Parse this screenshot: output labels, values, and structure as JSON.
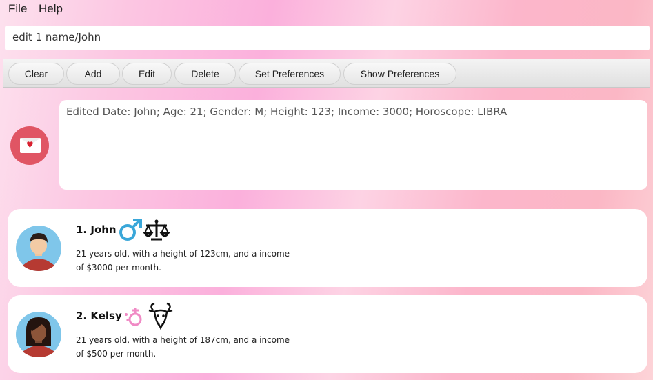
{
  "menu": {
    "file": "File",
    "help": "Help"
  },
  "command": {
    "value": "edit 1 name/John"
  },
  "toolbar": {
    "clear": "Clear",
    "add": "Add",
    "edit": "Edit",
    "delete": "Delete",
    "set_preferences": "Set Preferences",
    "show_preferences": "Show Preferences"
  },
  "result": {
    "text": "Edited Date: John; Age: 21; Gender: M; Height: 123; Income: 3000; Horoscope: LIBRA"
  },
  "cards": [
    {
      "title": "1.  John",
      "gender_icon": "male-symbol-icon",
      "horoscope_icon": "libra-icon",
      "description": "21 years old, with a height of 123cm, and a income of $3000 per month."
    },
    {
      "title": "2.  Kelsy",
      "gender_icon": "female-symbol-icon",
      "horoscope_icon": "capricorn-goat-icon",
      "description": "21 years old, with a height of 187cm, and a income of $500 per month."
    }
  ],
  "colors": {
    "accent": "#e05564",
    "male": "#3aa7d9",
    "female": "#f08ac5"
  }
}
